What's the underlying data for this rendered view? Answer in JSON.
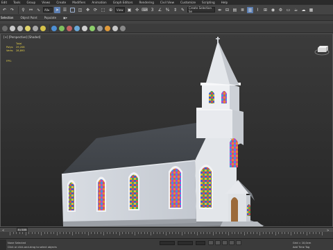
{
  "menu": [
    "Edit",
    "Tools",
    "Group",
    "Views",
    "Create",
    "Modifiers",
    "Animation",
    "Graph Editors",
    "Rendering",
    "Civil View",
    "Customize",
    "Scripting",
    "Help"
  ],
  "toolbar": {
    "ref_coord": "View",
    "selection_set": "Create Selection Se"
  },
  "ribbon_tabs": [
    "Selection",
    "Object Paint",
    "Populate"
  ],
  "viewport": {
    "label": "[+] [Perspective] [Shaded]",
    "stats_title": "Total",
    "polys_label": "Polys:",
    "polys_value": "29,208",
    "verts_label": "Verts:",
    "verts_value": "28,893",
    "fps_label": "FPS:"
  },
  "timeline": {
    "frame": "0 / 100"
  },
  "status": {
    "line1": "None Selected",
    "line2": "Click or click-and-drag to select objects",
    "grid": "Grid = 10,0cm",
    "add_time_tag": "Add Time Tag"
  }
}
